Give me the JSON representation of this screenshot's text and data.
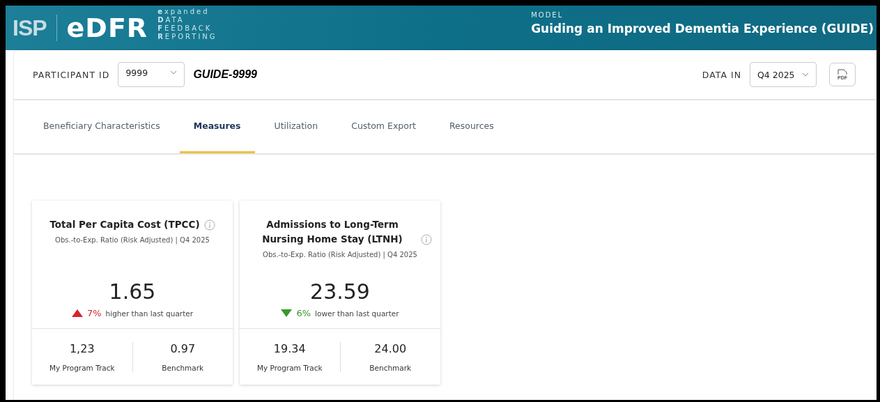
{
  "header": {
    "org_logo": "ISP",
    "product_logo": "eDFR",
    "tagline": [
      "**e**xpanded",
      "**D**ATA",
      "**F**EEDBACK",
      "**R**EPORTING"
    ],
    "model_label": "MODEL",
    "model_name": "Guiding an Improved Dementia Experience (GUIDE)"
  },
  "toolbar": {
    "participant_label": "PARTICIPANT ID",
    "participant_value": "9999",
    "participant_name": "GUIDE-9999",
    "data_in_label": "DATA IN",
    "data_in_value": "Q4 2025",
    "pdf_label": "PDF"
  },
  "tabs": [
    {
      "label": "Beneficiary Characteristics",
      "selected": false
    },
    {
      "label": "Measures",
      "selected": true
    },
    {
      "label": "Utilization",
      "selected": false
    },
    {
      "label": "Custom Export",
      "selected": false
    },
    {
      "label": "Resources",
      "selected": false
    }
  ],
  "measures": [
    {
      "title": "Total Per Capita Cost (TPCC)",
      "subtitle": "Obs.-to-Exp. Ratio (Risk Adjusted) | Q4 2025",
      "value": "1.65",
      "increase": true,
      "change": "7%",
      "change_text": "higher than last quarter",
      "stats": [
        {
          "value": "1,23",
          "label": "My Program Track"
        },
        {
          "value": "0.97",
          "label": "Benchmark"
        }
      ]
    },
    {
      "title": "Admissions to Long-Term Nursing Home Stay (LTNH)",
      "subtitle": "Obs.-to-Exp. Ratio (Risk Adjusted) | Q4 2025",
      "value": "23.59",
      "increase": false,
      "change": "6%",
      "change_text": "lower than last quarter",
      "stats": [
        {
          "value": "19.34",
          "label": "My Program Track"
        },
        {
          "value": "24.00",
          "label": "Benchmark"
        }
      ]
    }
  ]
}
